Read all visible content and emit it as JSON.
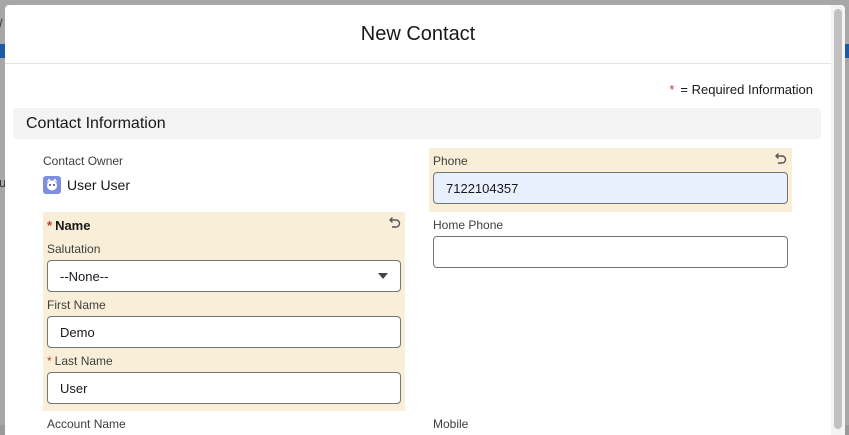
{
  "backdrop": {
    "left_fragment": "u",
    "top_fragment": "/"
  },
  "modal": {
    "title": "New Contact"
  },
  "required_note": {
    "star": "*",
    "text": "= Required Information"
  },
  "section": {
    "title": "Contact Information"
  },
  "contact_owner": {
    "label": "Contact Owner",
    "value": "User User"
  },
  "name_group": {
    "label": "Name",
    "salutation_label": "Salutation",
    "salutation_value": "--None--",
    "first_name_label": "First Name",
    "first_name_value": "Demo",
    "last_name_label": "Last Name",
    "last_name_value": "User"
  },
  "phone": {
    "label": "Phone",
    "value": "7122104357"
  },
  "home_phone": {
    "label": "Home Phone",
    "value": ""
  },
  "account_name": {
    "label": "Account Name"
  },
  "mobile": {
    "label": "Mobile"
  },
  "colors": {
    "required": "#c23934",
    "changed_bg": "#f9efd9",
    "autofill_bg": "#e8f0fe"
  }
}
